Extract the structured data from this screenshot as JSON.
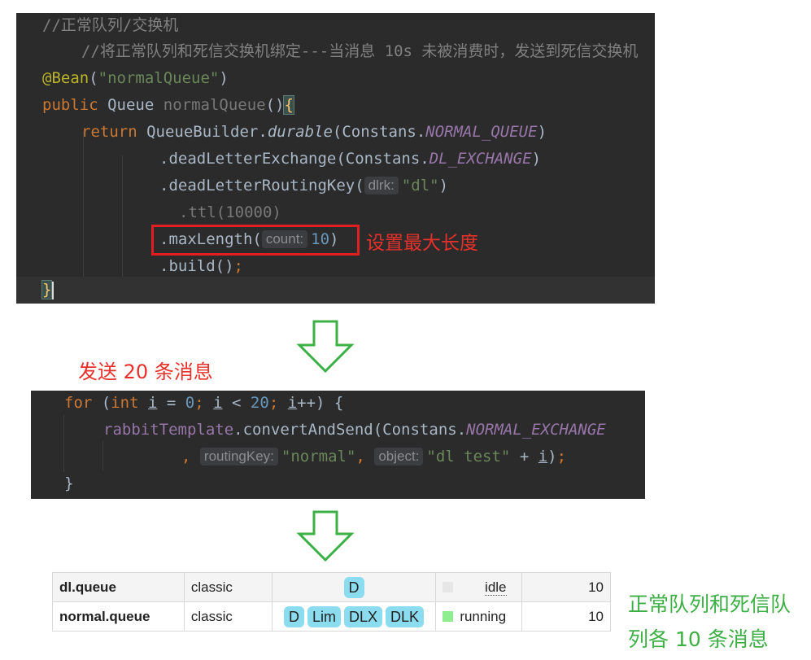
{
  "code1": {
    "comment1": "//正常队列/交换机",
    "comment2": "//将正常队列和死信交换机绑定---当消息 10s 未被消费时，发送到死信交换机",
    "annotation": "@Bean",
    "annotation_arg": "\"normalQueue\"",
    "kw_public": "public",
    "type_queue": "Queue",
    "method_name": "normalQueue",
    "kw_return": "return",
    "builder": "QueueBuilder.",
    "durable": "durable",
    "constans": "Constans.",
    "normal_queue": "NORMAL_QUEUE",
    "dle": ".deadLetterExchange(",
    "dl_exchange": "DL_EXCHANGE",
    "dlrk": ".deadLetterRoutingKey(",
    "dlrk_hint": "dlrk:",
    "dlrk_arg": "\"dl\"",
    "ttl": ".ttl(10000)",
    "maxlen": ".maxLength(",
    "count_hint": "count:",
    "count_val": "10",
    "build": ".build()",
    "semicolon": ";",
    "brace_open": "{",
    "brace_close": "}"
  },
  "annotations": {
    "max_length_note": "设置最大长度",
    "send_note": "发送 20 条消息",
    "result_note_line1": "正常队列和死信队",
    "result_note_line2": "列各 10 条消息"
  },
  "code2": {
    "kw_for": "for",
    "kw_int": "int",
    "var_i": "i",
    "zero": "0",
    "twenty": "20",
    "template": "rabbitTemplate.convertAndSend(Constans.",
    "normal_exchange": "NORMAL_EXCHANGE",
    "routing_hint": "routingKey:",
    "routing_val": "\"normal\"",
    "object_hint": "object:",
    "object_val": "\"dl test\"",
    "close_brace": "}"
  },
  "queues": [
    {
      "name": "dl.queue",
      "type": "classic",
      "features": [
        "D"
      ],
      "state": "idle",
      "state_color": "#e6e6e6",
      "count": "10"
    },
    {
      "name": "normal.queue",
      "type": "classic",
      "features": [
        "D",
        "Lim",
        "DLX",
        "DLK"
      ],
      "state": "running",
      "state_color": "#90ee90",
      "count": "10"
    }
  ],
  "colors": {
    "note_red": "#e8302b",
    "note_green": "#3cb044",
    "arrow_green": "#3cb044",
    "editor_bg": "#2b2b2b"
  }
}
